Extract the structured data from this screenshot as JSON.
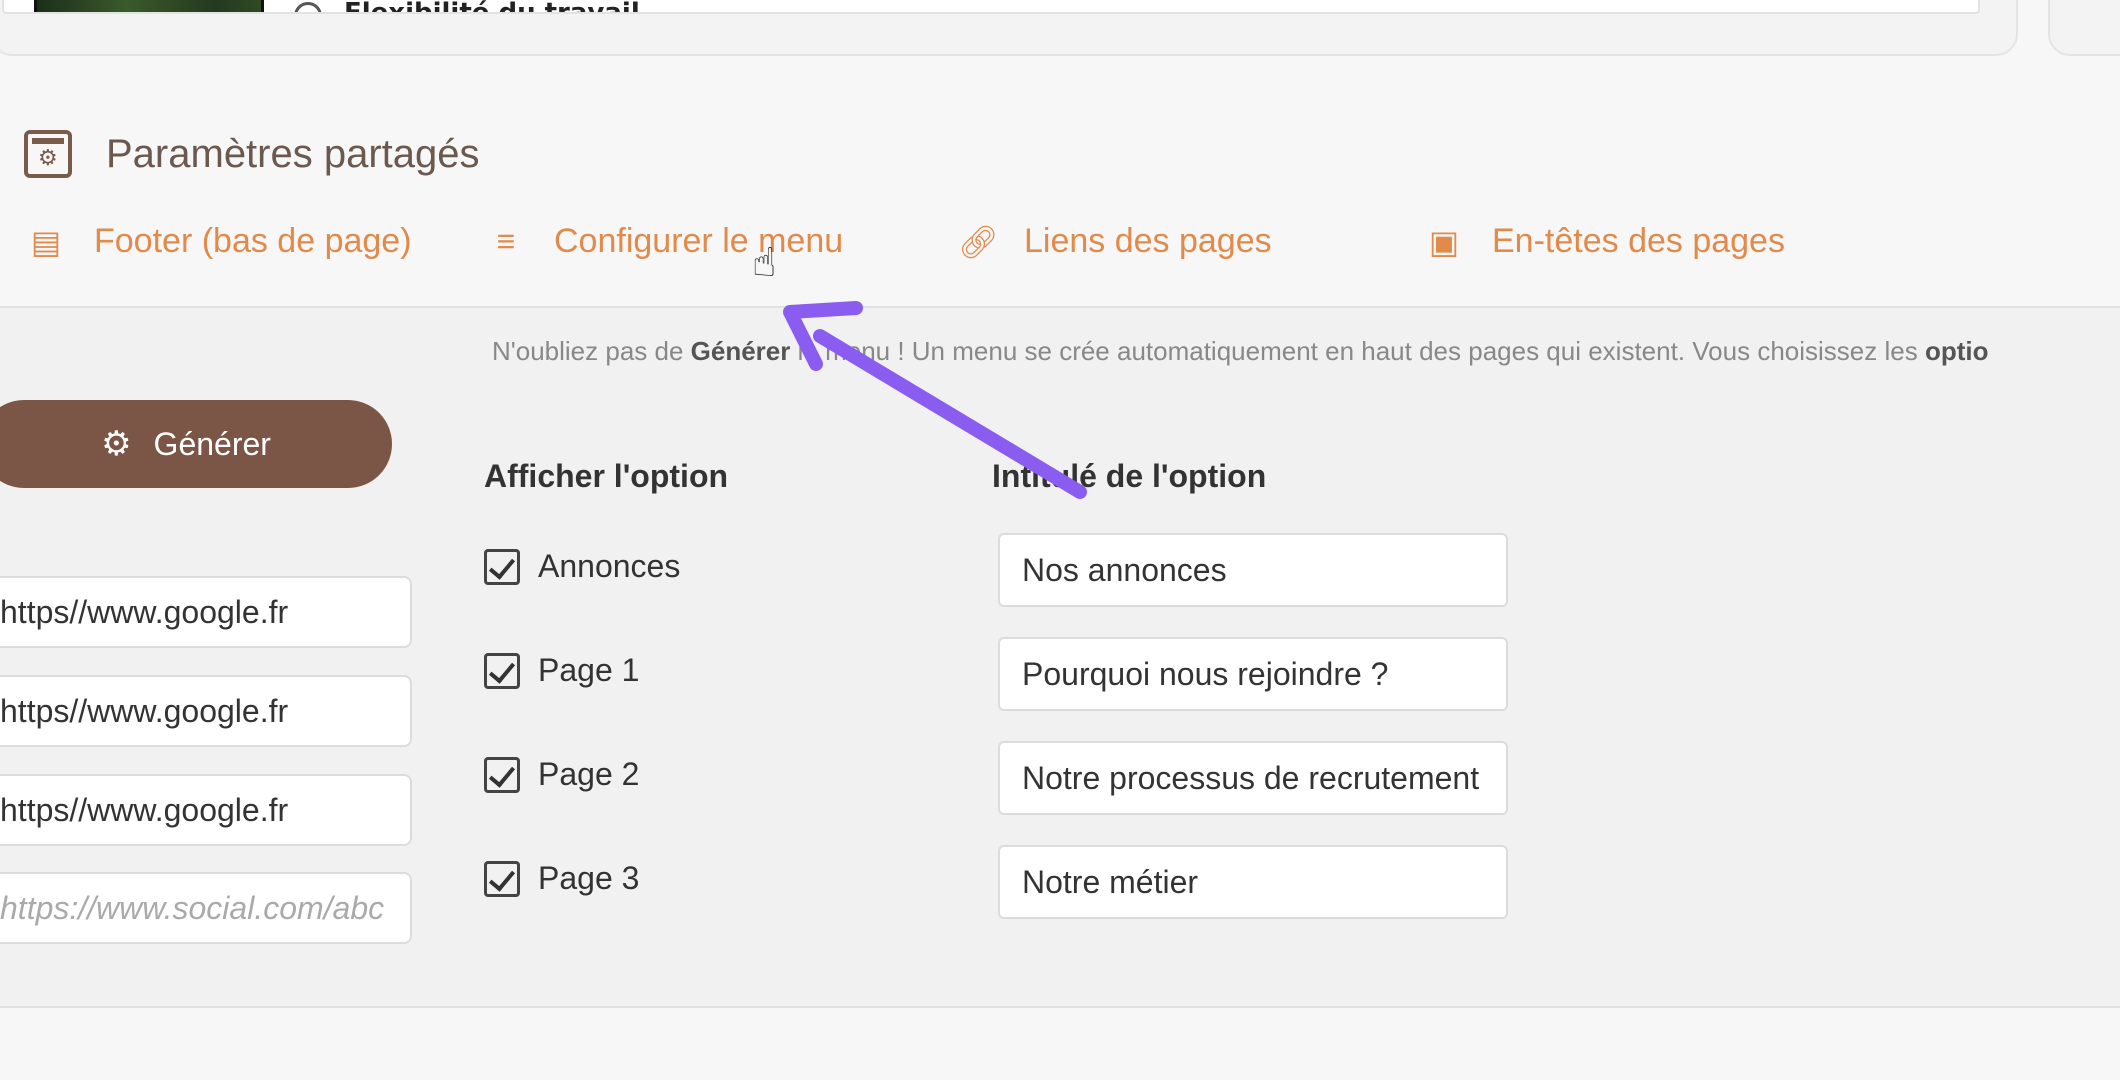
{
  "top": {
    "partial_text": "Flexibilité du travail"
  },
  "shared": {
    "title": "Paramètres partagés",
    "icon": "settings-page-icon"
  },
  "tabs": [
    {
      "label": "Footer (bas de page)",
      "icon": "calendar-icon"
    },
    {
      "label": "Configurer le menu",
      "icon": "menu-lines-icon"
    },
    {
      "label": "Liens des pages",
      "icon": "link-icon"
    },
    {
      "label": "En-têtes des pages",
      "icon": "image-icon"
    }
  ],
  "notice": {
    "prefix": "N'oubliez pas de ",
    "bold1": "Générer",
    "middle": " le menu ! Un menu se crée automatiquement en haut des pages qui existent. Vous choisissez les ",
    "bold2": "optio"
  },
  "generate_button": {
    "label": "Générer",
    "icon": "gears-icon"
  },
  "url_inputs": [
    {
      "value": "https//www.google.fr",
      "placeholder": ""
    },
    {
      "value": "https//www.google.fr",
      "placeholder": ""
    },
    {
      "value": "https//www.google.fr",
      "placeholder": ""
    },
    {
      "value": "",
      "placeholder": "https://www.social.com/abc"
    }
  ],
  "columns": {
    "show": "Afficher l'option",
    "label": "Intitulé de l'option"
  },
  "options": [
    {
      "name": "Annonces",
      "checked": true,
      "label_value": "Nos annonces"
    },
    {
      "name": "Page 1",
      "checked": true,
      "label_value": "Pourquoi nous rejoindre ?"
    },
    {
      "name": "Page 2",
      "checked": true,
      "label_value": "Notre processus de recrutement"
    },
    {
      "name": "Page 3",
      "checked": true,
      "label_value": "Notre métier"
    }
  ],
  "colors": {
    "accent": "#e18a4a",
    "button": "#7b5646",
    "arrow": "#8a5cf0"
  }
}
